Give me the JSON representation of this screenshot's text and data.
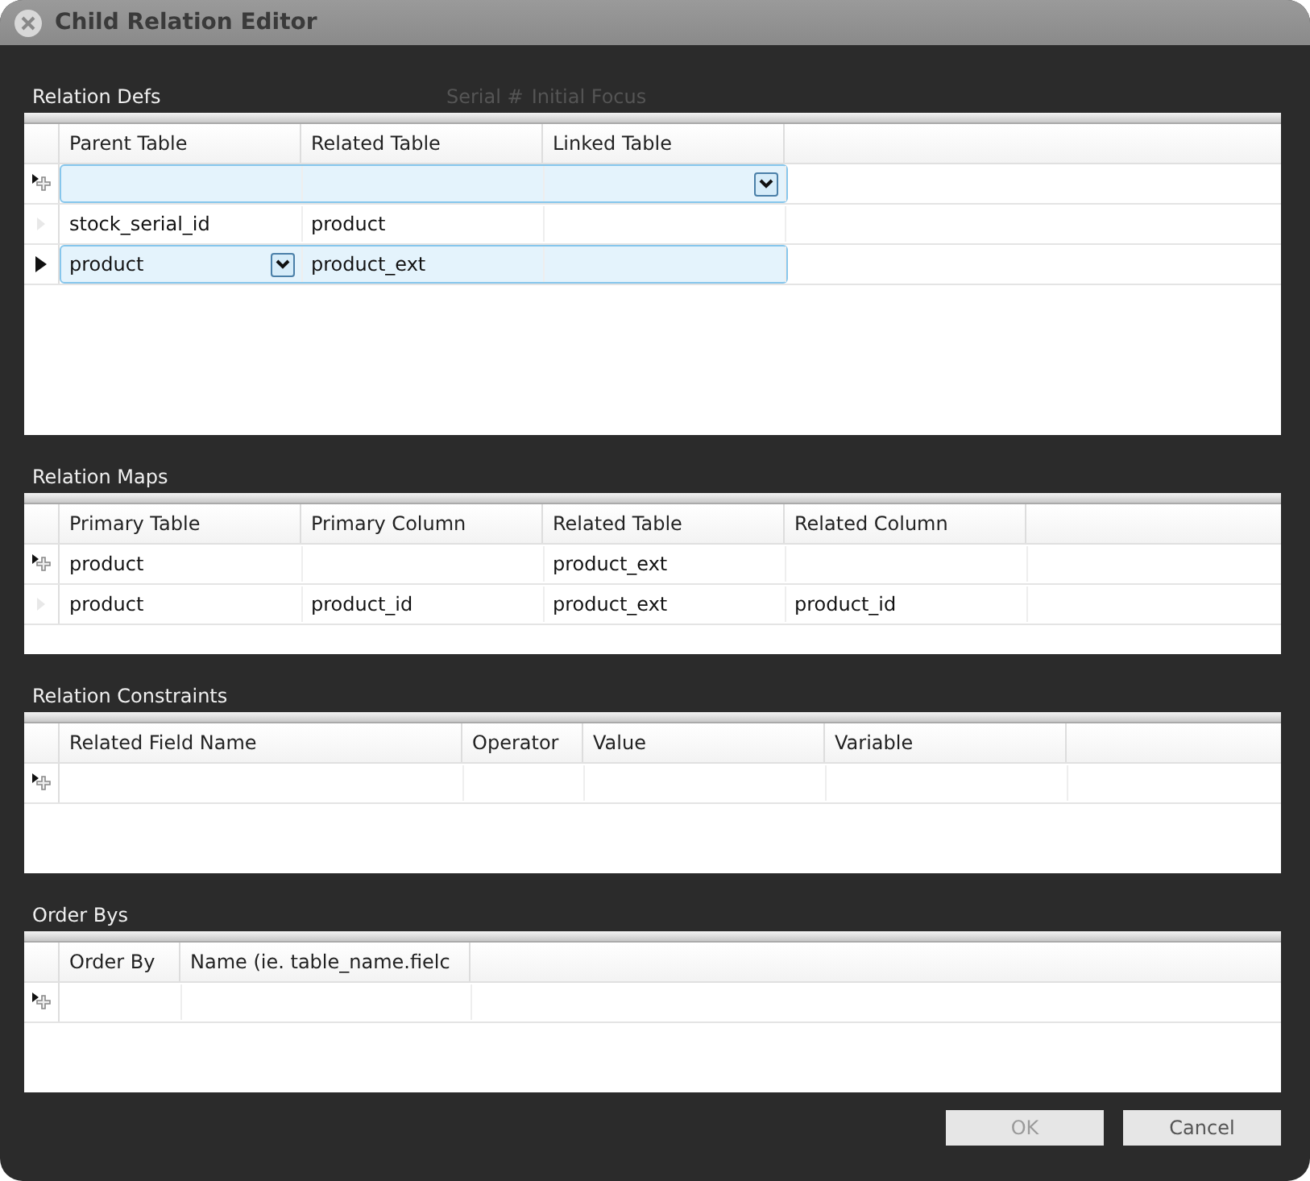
{
  "window": {
    "title": "Child Relation Editor"
  },
  "background_texts": [
    "Serial #",
    "Initial Focus"
  ],
  "sections": [
    {
      "title": "Relation Defs",
      "columns": [
        "Parent Table",
        "Related Table",
        "Linked Table"
      ],
      "rows": [
        {
          "kind": "new",
          "selected": true,
          "cells": [
            {},
            {},
            {
              "dropdown": true
            }
          ]
        },
        {
          "kind": "plain",
          "selected": false,
          "cells": [
            {
              "text": "stock_serial_id"
            },
            {
              "text": "product"
            },
            {}
          ]
        },
        {
          "kind": "current",
          "selected": true,
          "cells": [
            {
              "text": "product",
              "dropdown": true
            },
            {
              "text": "product_ext"
            },
            {}
          ]
        }
      ]
    },
    {
      "title": "Relation Maps",
      "columns": [
        "Primary Table",
        "Primary Column",
        "Related Table",
        "Related Column"
      ],
      "rows": [
        {
          "kind": "new",
          "selected": false,
          "cells": [
            {
              "text": "product"
            },
            {},
            {
              "text": "product_ext"
            },
            {}
          ]
        },
        {
          "kind": "plain",
          "selected": false,
          "cells": [
            {
              "text": "product"
            },
            {
              "text": "product_id"
            },
            {
              "text": "product_ext"
            },
            {
              "text": "product_id"
            }
          ]
        }
      ]
    },
    {
      "title": "Relation Constraints",
      "columns": [
        "Related Field Name",
        "Operator",
        "Value",
        "Variable"
      ],
      "rows": [
        {
          "kind": "new",
          "selected": false,
          "cells": [
            {},
            {},
            {},
            {}
          ]
        }
      ]
    },
    {
      "title": "Order Bys",
      "columns": [
        "Order By",
        "Name (ie. table_name.fielc"
      ],
      "rows": [
        {
          "kind": "new",
          "selected": false,
          "cells": [
            {},
            {}
          ]
        }
      ]
    }
  ],
  "buttons": [
    {
      "label": "OK",
      "disabled": true
    },
    {
      "label": "Cancel",
      "disabled": false
    }
  ]
}
